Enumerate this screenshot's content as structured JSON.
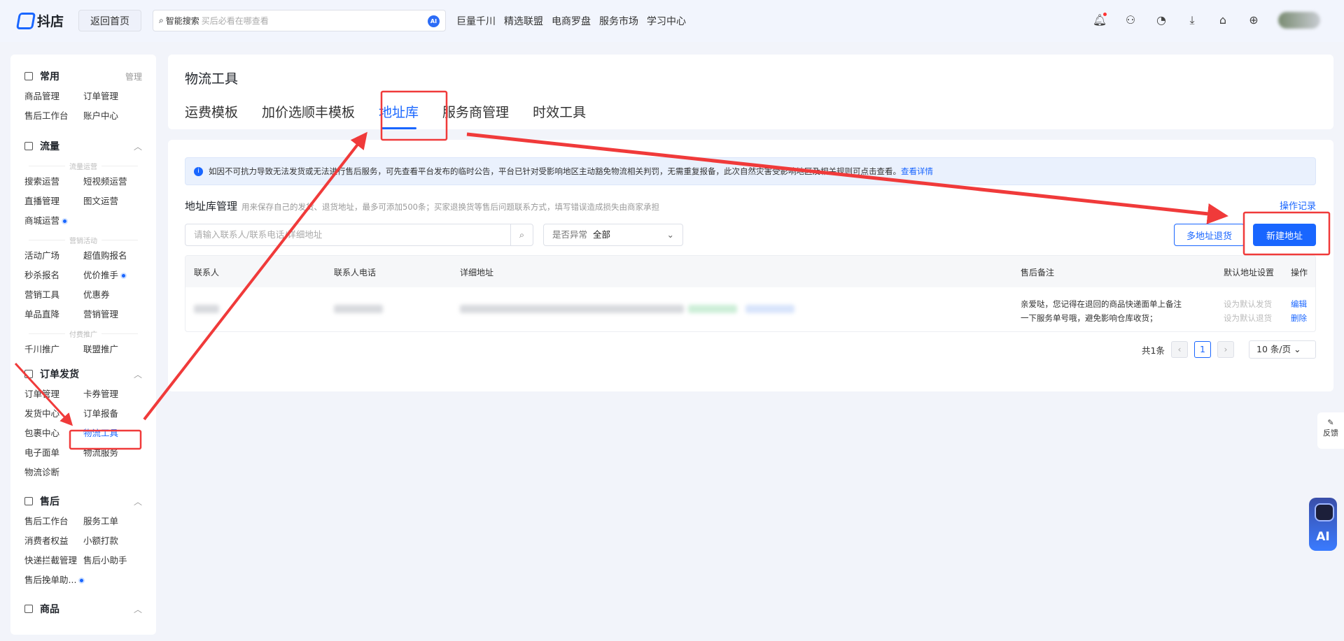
{
  "header": {
    "logo": "抖店",
    "home": "返回首页",
    "search_label": "智能搜索",
    "search_placeholder": "买后必看在哪查看",
    "ai": "AI",
    "nav": [
      "巨量千川",
      "精选联盟",
      "电商罗盘",
      "服务市场",
      "学习中心"
    ]
  },
  "sidebar": {
    "common": {
      "title": "常用",
      "manage": "管理",
      "items": [
        "商品管理",
        "订单管理",
        "售后工作台",
        "账户中心"
      ]
    },
    "traffic": {
      "title": "流量",
      "groups": [
        {
          "label": "流量运营",
          "items": [
            "搜索运营",
            "短视频运营",
            "直播管理",
            "图文运营",
            "商城运营"
          ]
        },
        {
          "label": "营销活动",
          "items": [
            "活动广场",
            "超值购报名",
            "秒杀报名",
            "优价推手",
            "营销工具",
            "优惠券",
            "单品直降",
            "营销管理"
          ]
        },
        {
          "label": "付费推广",
          "items": [
            "千川推广",
            "联盟推广"
          ]
        }
      ]
    },
    "orders": {
      "title": "订单发货",
      "items": [
        "订单管理",
        "卡券管理",
        "发货中心",
        "订单报备",
        "包裹中心",
        "物流工具",
        "电子面单",
        "物流服务",
        "物流诊断"
      ]
    },
    "aftersale": {
      "title": "售后",
      "items": [
        "售后工作台",
        "服务工单",
        "消费者权益",
        "小额打款",
        "快递拦截管理",
        "售后小助手",
        "售后挽单助..."
      ]
    },
    "goods": {
      "title": "商品"
    }
  },
  "page": {
    "title": "物流工具",
    "tabs": [
      "运费模板",
      "加价选顺丰模板",
      "地址库",
      "服务商管理",
      "时效工具"
    ],
    "active_tab": "地址库"
  },
  "notice": {
    "text": "如因不可抗力导致无法发货或无法进行售后服务，可先查看平台发布的临时公告，平台已针对受影响地区主动豁免物流相关判罚，无需重复报备，此次自然灾害受影响地区及相关规则可点击查看。",
    "link": "查看详情"
  },
  "address": {
    "title": "地址库管理",
    "desc": "用来保存自己的发货、退货地址，最多可添加500条；买家退换货等售后问题联系方式，填写错误造成损失由商家承担",
    "op_log": "操作记录",
    "search_placeholder": "请输入联系人/联系电话/详细地址",
    "filter_label": "是否异常",
    "filter_value": "全部",
    "btn_multi": "多地址退货",
    "btn_new": "新建地址",
    "columns": [
      "联系人",
      "联系人电话",
      "详细地址",
      "售后备注",
      "默认地址设置",
      "操作"
    ],
    "row": {
      "note": "亲爱哒，您记得在退回的商品快递面单上备注一下服务单号哦，避免影响仓库收货；",
      "set_ship": "设为默认发货",
      "set_return": "设为默认退货",
      "edit": "编辑",
      "delete": "删除"
    },
    "pagination": {
      "total": "共1条",
      "current": "1",
      "page_size": "10 条/页"
    }
  },
  "float": {
    "feedback": "反馈",
    "ai": "AI"
  },
  "colors": {
    "accent": "#1966ff",
    "annotation": "#f03a3a"
  }
}
